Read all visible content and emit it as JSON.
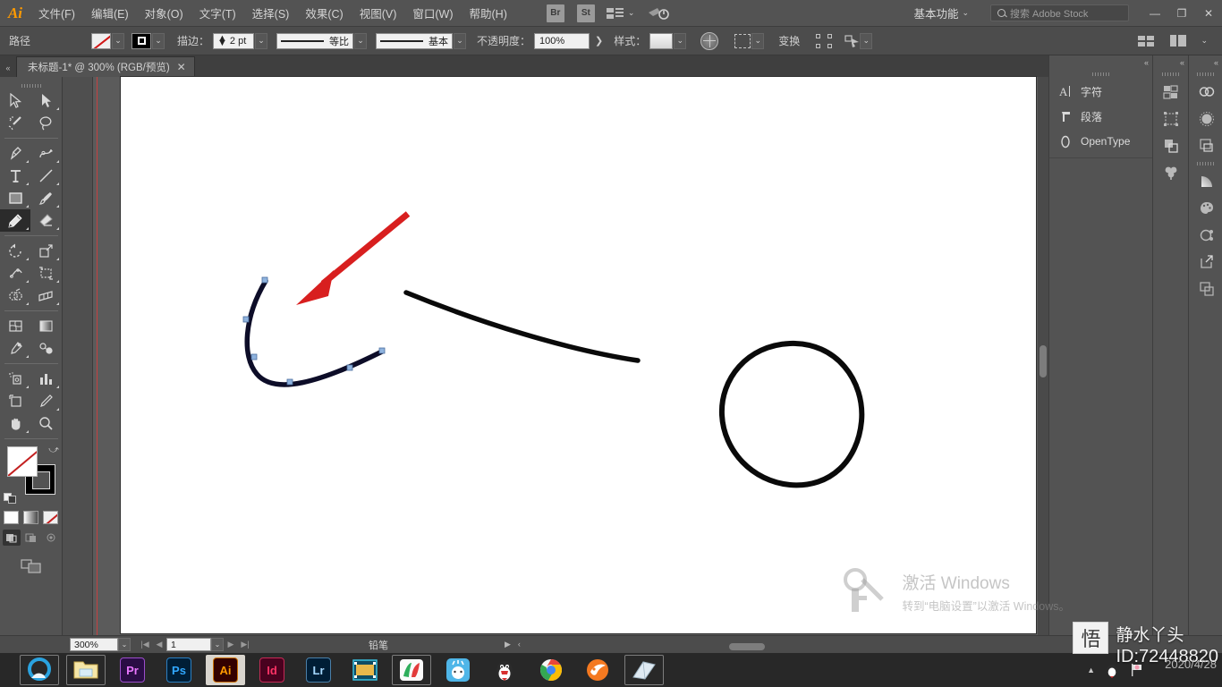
{
  "app": {
    "logo": "Ai",
    "title_icons": [
      "bridge-badge",
      "stock-badge"
    ]
  },
  "menubar": {
    "items": [
      {
        "label": "文件(F)",
        "name": "menu-file"
      },
      {
        "label": "编辑(E)",
        "name": "menu-edit"
      },
      {
        "label": "对象(O)",
        "name": "menu-object"
      },
      {
        "label": "文字(T)",
        "name": "menu-type"
      },
      {
        "label": "选择(S)",
        "name": "menu-select"
      },
      {
        "label": "效果(C)",
        "name": "menu-effect"
      },
      {
        "label": "视图(V)",
        "name": "menu-view"
      },
      {
        "label": "窗口(W)",
        "name": "menu-window"
      },
      {
        "label": "帮助(H)",
        "name": "menu-help"
      }
    ],
    "bridge_label": "Br",
    "stock_label": "St",
    "workspace": "基本功能",
    "search_placeholder": "搜索 Adobe Stock",
    "window_minimize": "—",
    "window_restore": "❐",
    "window_close": "✕"
  },
  "controlbar": {
    "object_label": "路径",
    "stroke_label": "描边：",
    "stroke_width": "2 pt",
    "stroke_profile": "等比",
    "brush_definition": "基本",
    "opacity_label": "不透明度：",
    "opacity_value": "100%",
    "style_label": "样式：",
    "transform_label": "变换"
  },
  "tabbar": {
    "document_tab": "未标题-1* @ 300% (RGB/预览)",
    "close_glyph": "✕"
  },
  "toolbar": {
    "tools": [
      {
        "name": "selection-tool",
        "label": "选择工具"
      },
      {
        "name": "direct-selection-tool",
        "label": "直接选择工具"
      },
      {
        "name": "magic-wand-tool",
        "label": "魔棒工具"
      },
      {
        "name": "lasso-tool",
        "label": "套索工具"
      },
      {
        "name": "pen-tool",
        "label": "钢笔工具"
      },
      {
        "name": "curvature-tool",
        "label": "曲率工具"
      },
      {
        "name": "type-tool",
        "label": "文字工具"
      },
      {
        "name": "line-segment-tool",
        "label": "直线段工具"
      },
      {
        "name": "rectangle-tool",
        "label": "矩形工具"
      },
      {
        "name": "paintbrush-tool",
        "label": "画笔工具"
      },
      {
        "name": "pencil-tool",
        "label": "铅笔工具"
      },
      {
        "name": "eraser-tool",
        "label": "橡皮擦工具"
      },
      {
        "name": "rotate-tool",
        "label": "旋转工具"
      },
      {
        "name": "scale-tool",
        "label": "比例缩放工具"
      },
      {
        "name": "width-tool",
        "label": "宽度工具"
      },
      {
        "name": "free-transform-tool",
        "label": "自由变换工具"
      },
      {
        "name": "shape-builder-tool",
        "label": "形状生成器工具"
      },
      {
        "name": "perspective-grid-tool",
        "label": "透视网格工具"
      },
      {
        "name": "mesh-tool",
        "label": "网格工具"
      },
      {
        "name": "gradient-tool",
        "label": "渐变工具"
      },
      {
        "name": "eyedropper-tool",
        "label": "吸管工具"
      },
      {
        "name": "blend-tool",
        "label": "混合工具"
      },
      {
        "name": "symbol-sprayer-tool",
        "label": "符号喷枪工具"
      },
      {
        "name": "column-graph-tool",
        "label": "柱形图工具"
      },
      {
        "name": "artboard-tool",
        "label": "画板工具"
      },
      {
        "name": "slice-tool",
        "label": "切片工具"
      },
      {
        "name": "hand-tool",
        "label": "抓手工具"
      },
      {
        "name": "zoom-tool",
        "label": "缩放工具"
      }
    ],
    "active_tool": "pencil-tool",
    "fill": "none",
    "stroke_color": "#000000"
  },
  "artwork": {
    "selected_path_color": "#0d0d28",
    "anchor_color": "#6f9fd8",
    "arrow_color": "#d81f1f",
    "shapes": [
      {
        "name": "selected-u-curve",
        "selected": true
      },
      {
        "name": "red-annotation-arrow",
        "selected": false
      },
      {
        "name": "black-diagonal-stroke",
        "selected": false
      },
      {
        "name": "black-circle-shape",
        "selected": false
      }
    ]
  },
  "right_panels": {
    "items": [
      {
        "label": "字符",
        "icon": "character-icon"
      },
      {
        "label": "段落",
        "icon": "paragraph-icon"
      },
      {
        "label": "OpenType",
        "icon": "opentype-icon"
      }
    ],
    "mid_icons": [
      "swatches-icon",
      "transform-icon",
      "pathfinder-icon",
      "brushes-icon"
    ],
    "right_icons": [
      "cc-libraries-icon",
      "appearance-icon",
      "layers-icon",
      "gradient-icon",
      "color-guide-icon",
      "symbols-icon",
      "export-icon",
      "artboards-icon"
    ],
    "collapse_glyph": "«"
  },
  "statusbar": {
    "zoom": "300%",
    "page": "1",
    "tool_name": "铅笔",
    "first_glyph": "|◀",
    "prev_glyph": "◀",
    "next_glyph": "▶",
    "last_glyph": "▶|"
  },
  "taskbar": {
    "items": [
      {
        "name": "taskbar-browser",
        "label": ""
      },
      {
        "name": "taskbar-file-explorer",
        "label": ""
      },
      {
        "name": "taskbar-premiere",
        "label": "Pr",
        "color": "#2a0d45",
        "fg": "#ea77ff"
      },
      {
        "name": "taskbar-photoshop",
        "label": "Ps",
        "color": "#001e36",
        "fg": "#31a8ff"
      },
      {
        "name": "taskbar-illustrator",
        "label": "Ai",
        "color": "#330000",
        "fg": "#ff9a00"
      },
      {
        "name": "taskbar-indesign",
        "label": "Id",
        "color": "#49021f",
        "fg": "#ff3366"
      },
      {
        "name": "taskbar-lightroom",
        "label": "Lr",
        "color": "#001e36",
        "fg": "#a5d8ff"
      },
      {
        "name": "taskbar-video-app",
        "label": ""
      },
      {
        "name": "taskbar-colorful-app",
        "label": ""
      },
      {
        "name": "taskbar-weather-app",
        "label": ""
      },
      {
        "name": "taskbar-qq",
        "label": ""
      },
      {
        "name": "taskbar-chrome",
        "label": ""
      },
      {
        "name": "taskbar-orange-browser",
        "label": ""
      },
      {
        "name": "taskbar-notepad",
        "label": ""
      }
    ],
    "active": "taskbar-illustrator"
  },
  "watermarks": {
    "windows_activate_title": "激活 Windows",
    "windows_activate_sub": "转到“电脑设置”以激活 Windows。",
    "user_logo": "悟",
    "user_name": "静水丫头",
    "user_id": "ID:72448820",
    "date": "2020/4/28"
  }
}
